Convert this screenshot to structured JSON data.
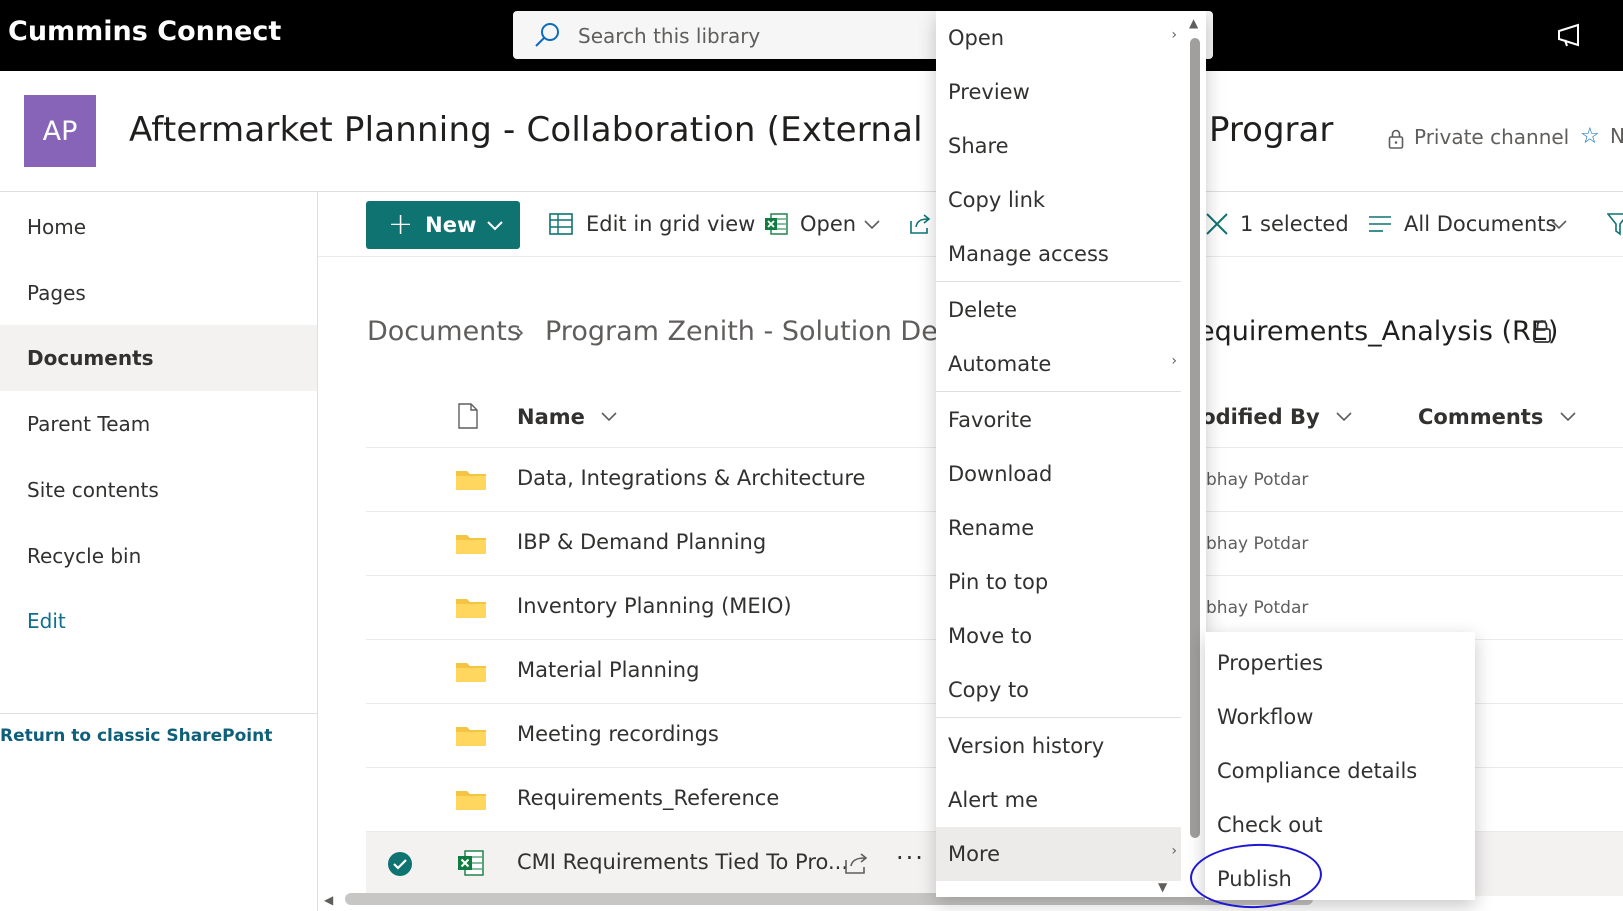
{
  "suite": {
    "brand": "Cummins Connect",
    "search_placeholder": "Search this library"
  },
  "site": {
    "avatar_initials": "AP",
    "title": "Aftermarket Planning - Collaboration (External Sh",
    "title_tail": "Prograr",
    "private_channel": "Private channel",
    "follow_tail": "N"
  },
  "nav": {
    "items": [
      {
        "label": "Home"
      },
      {
        "label": "Pages"
      },
      {
        "label": "Documents",
        "selected": true
      },
      {
        "label": "Parent Team"
      },
      {
        "label": "Site contents"
      },
      {
        "label": "Recycle bin"
      }
    ],
    "edit": "Edit",
    "classic": "Return to classic SharePoint"
  },
  "commandbar": {
    "new_label": "New",
    "grid_label": "Edit in grid view",
    "open_label": "Open",
    "selected_label": "1 selected",
    "view_label": "All Documents"
  },
  "breadcrumb": {
    "root": "Documents",
    "middle": "Program Zenith - Solution Delive",
    "current": "equirements_Analysis (RE)"
  },
  "list": {
    "columns": {
      "name": "Name",
      "modified_by": "lodified By",
      "comments": "Comments"
    },
    "rows": [
      {
        "name": "Data, Integrations & Architecture",
        "modified_by": "bhay Potdar",
        "type": "folder"
      },
      {
        "name": "IBP & Demand Planning",
        "modified_by": "bhay Potdar",
        "type": "folder"
      },
      {
        "name": "Inventory Planning (MEIO)",
        "modified_by": "bhay Potdar",
        "type": "folder"
      },
      {
        "name": "Material Planning",
        "modified_by": "",
        "type": "folder"
      },
      {
        "name": "Meeting recordings",
        "modified_by": "",
        "type": "folder"
      },
      {
        "name": "Requirements_Reference",
        "modified_by": "",
        "type": "folder"
      },
      {
        "name": "CMI Requirements Tied To Pro...",
        "modified_by": "",
        "type": "excel",
        "selected": true
      }
    ]
  },
  "context_menu": {
    "items": [
      "Open",
      "Preview",
      "Share",
      "Copy link",
      "Manage access",
      "Delete",
      "Automate",
      "Favorite",
      "Download",
      "Rename",
      "Pin to top",
      "Move to",
      "Copy to",
      "Version history",
      "Alert me",
      "More"
    ]
  },
  "submenu": {
    "items": [
      "Properties",
      "Workflow",
      "Compliance details",
      "Check out",
      "Publish"
    ]
  },
  "colors": {
    "accent": "#0f7372",
    "avatar": "#8764b8",
    "annotation": "#1f17d4"
  }
}
